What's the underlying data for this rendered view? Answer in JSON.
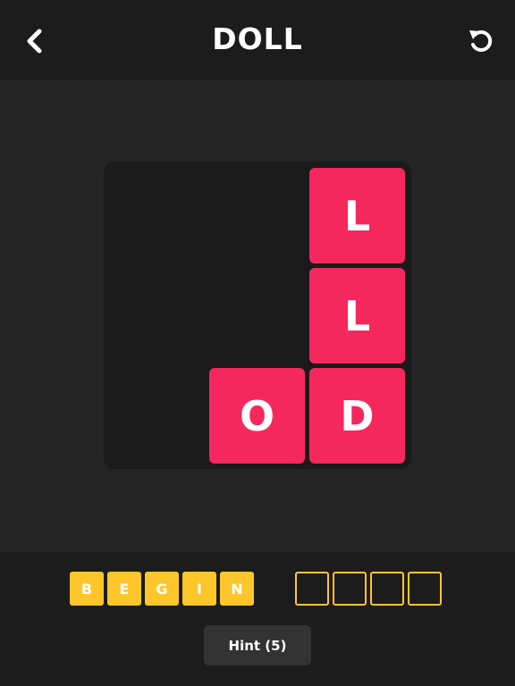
{
  "header": {
    "title": "DOLL",
    "back_icon": "chevron-left-icon",
    "undo_icon": "undo-icon"
  },
  "board": {
    "tiles": [
      {
        "letter": "L",
        "row": 0,
        "col": 2
      },
      {
        "letter": "L",
        "row": 1,
        "col": 2
      },
      {
        "letter": "O",
        "row": 2,
        "col": 1
      },
      {
        "letter": "D",
        "row": 2,
        "col": 2
      }
    ]
  },
  "word_bar": {
    "letters": [
      "B",
      "E",
      "G",
      "I",
      "N"
    ],
    "empty_slots": 4
  },
  "hint": {
    "label": "Hint (5)"
  },
  "colors": {
    "background": "#242424",
    "header": "#1c1c1c",
    "board": "#1a1a1a",
    "tile": "#f5285e",
    "letter_box": "#ffc62b",
    "hint_button": "#333333",
    "text": "#ffffff"
  }
}
